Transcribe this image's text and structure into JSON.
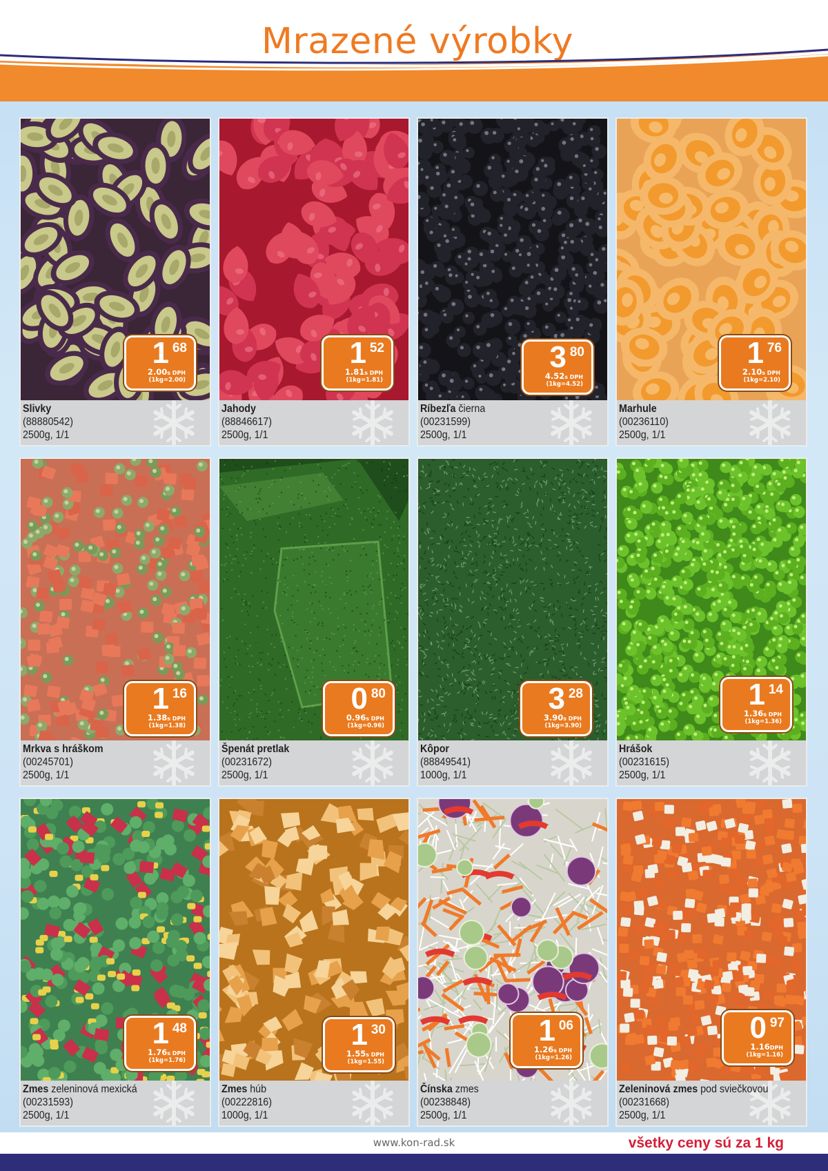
{
  "page": {
    "title": "Mrazené výrobky",
    "footer_url": "www.kon-rad.sk",
    "footer_note": "všetky ceny sú za 1 kg"
  },
  "colors": {
    "brand_orange": "#ee7a22",
    "brand_navy": "#2d2d7a",
    "badge_orange": "#e97a1f",
    "footer_red": "#d41e3a"
  },
  "products": [
    {
      "name_bold": "Slivky",
      "name_rest": "",
      "code": "(88880542)",
      "pack": "2500g, 1/1",
      "price_whole": "1",
      "price_cents": "68",
      "price_vat": "2.00",
      "vat_suffix": "s DPH",
      "unit_note": "(1kg=2.00)",
      "image": "plums"
    },
    {
      "name_bold": "Jahody",
      "name_rest": "",
      "code": "(88846617)",
      "pack": "2500g, 1/1",
      "price_whole": "1",
      "price_cents": "52",
      "price_vat": "1.81",
      "vat_suffix": "s DPH",
      "unit_note": "(1kg=1.81)",
      "image": "strawberries"
    },
    {
      "name_bold": "Ríbezľa",
      "name_rest": " čierna",
      "code": "(00231599)",
      "pack": "2500g, 1/1",
      "price_whole": "3",
      "price_cents": "80",
      "price_vat": "4.52",
      "vat_suffix": "s DPH",
      "unit_note": "(1kg=4.52)",
      "image": "blackcurrants"
    },
    {
      "name_bold": "Marhule",
      "name_rest": "",
      "code": "(00236110)",
      "pack": "2500g, 1/1",
      "price_whole": "1",
      "price_cents": "76",
      "price_vat": "2.10",
      "vat_suffix": "s DPH",
      "unit_note": "(1kg=2.10)",
      "image": "apricots"
    },
    {
      "name_bold": "Mrkva s hráškom",
      "name_rest": "",
      "code": "(00245701)",
      "pack": "2500g, 1/1",
      "price_whole": "1",
      "price_cents": "16",
      "price_vat": "1.38",
      "vat_suffix": "s DPH",
      "unit_note": "(1kg=1.38)",
      "image": "carrot-peas"
    },
    {
      "name_bold": "Špenát pretlak",
      "name_rest": "",
      "code": "(00231672)",
      "pack": "2500g, 1/1",
      "price_whole": "0",
      "price_cents": "80",
      "price_vat": "0.96",
      "vat_suffix": "s DPH",
      "unit_note": "(1kg=0.96)",
      "image": "spinach"
    },
    {
      "name_bold": "Kôpor",
      "name_rest": "",
      "code": "(88849541)",
      "pack": "1000g, 1/1",
      "price_whole": "3",
      "price_cents": "28",
      "price_vat": "3.90",
      "vat_suffix": "s DPH",
      "unit_note": "(1kg=3.90)",
      "image": "dill"
    },
    {
      "name_bold": "Hrášok",
      "name_rest": "",
      "code": "(00231615)",
      "pack": "2500g, 1/1",
      "price_whole": "1",
      "price_cents": "14",
      "price_vat": "1.36",
      "vat_suffix": "s DPH",
      "unit_note": "(1kg=1.36)",
      "image": "peas"
    },
    {
      "name_bold": "Zmes",
      "name_rest": " zeleninová mexická",
      "code": "(00231593)",
      "pack": "2500g, 1/1",
      "price_whole": "1",
      "price_cents": "48",
      "price_vat": "1.76",
      "vat_suffix": "s DPH",
      "unit_note": "(1kg=1.76)",
      "image": "mexican-mix"
    },
    {
      "name_bold": "Zmes",
      "name_rest": " húb",
      "code": "(00222816)",
      "pack": "1000g, 1/1",
      "price_whole": "1",
      "price_cents": "30",
      "price_vat": "1.55",
      "vat_suffix": "s DPH",
      "unit_note": "(1kg=1.55)",
      "image": "mushrooms"
    },
    {
      "name_bold": "Čínska",
      "name_rest": " zmes",
      "code": "(00238848)",
      "pack": "2500g, 1/1",
      "price_whole": "1",
      "price_cents": "06",
      "price_vat": "1.26",
      "vat_suffix": "s DPH",
      "unit_note": "(1kg=1.26)",
      "image": "chinese-mix"
    },
    {
      "name_bold": "Zeleninová zmes",
      "name_rest": " pod sviečkovou",
      "code": "(00231668)",
      "pack": "2500g, 1/1",
      "price_whole": "0",
      "price_cents": "97",
      "price_vat": "1.16",
      "vat_suffix": "DPH",
      "unit_note": "(1kg=1.16)",
      "image": "root-veg-mix"
    }
  ]
}
